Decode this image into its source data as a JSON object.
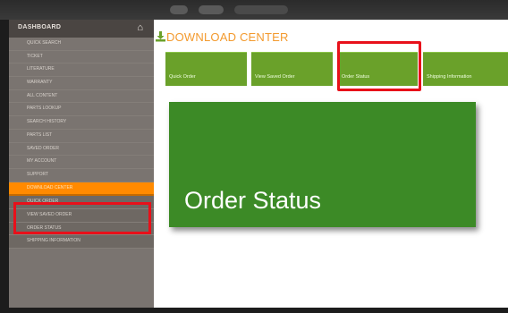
{
  "sidebar": {
    "header": "DASHBOARD",
    "items": [
      {
        "label": "QUICK SEARCH"
      },
      {
        "label": "TICKET"
      },
      {
        "label": "LITERATURE"
      },
      {
        "label": "WARRANTY"
      },
      {
        "label": "ALL CONTENT"
      },
      {
        "label": "PARTS LOOKUP"
      },
      {
        "label": "SEARCH HISTORY"
      },
      {
        "label": "PARTS LIST"
      },
      {
        "label": "SAVED ORDER"
      },
      {
        "label": "MY ACCOUNT"
      },
      {
        "label": "SUPPORT"
      },
      {
        "label": "DOWNLOAD CENTER"
      },
      {
        "label": "QUICK ORDER"
      },
      {
        "label": "VIEW SAVED ORDER"
      },
      {
        "label": "ORDER STATUS"
      },
      {
        "label": "SHIPPING INFORMATION"
      }
    ]
  },
  "main": {
    "title": "DOWNLOAD CENTER",
    "tabs": [
      {
        "label": "Quick Order"
      },
      {
        "label": "View Saved Order"
      },
      {
        "label": "Order Status"
      },
      {
        "label": "Shipping Information"
      }
    ],
    "panel_title": "Order Status"
  },
  "colors": {
    "accent_orange": "#f39a2e",
    "tab_green": "#6aa12a",
    "panel_green": "#3c8a26",
    "highlight_red": "#e8101a"
  }
}
